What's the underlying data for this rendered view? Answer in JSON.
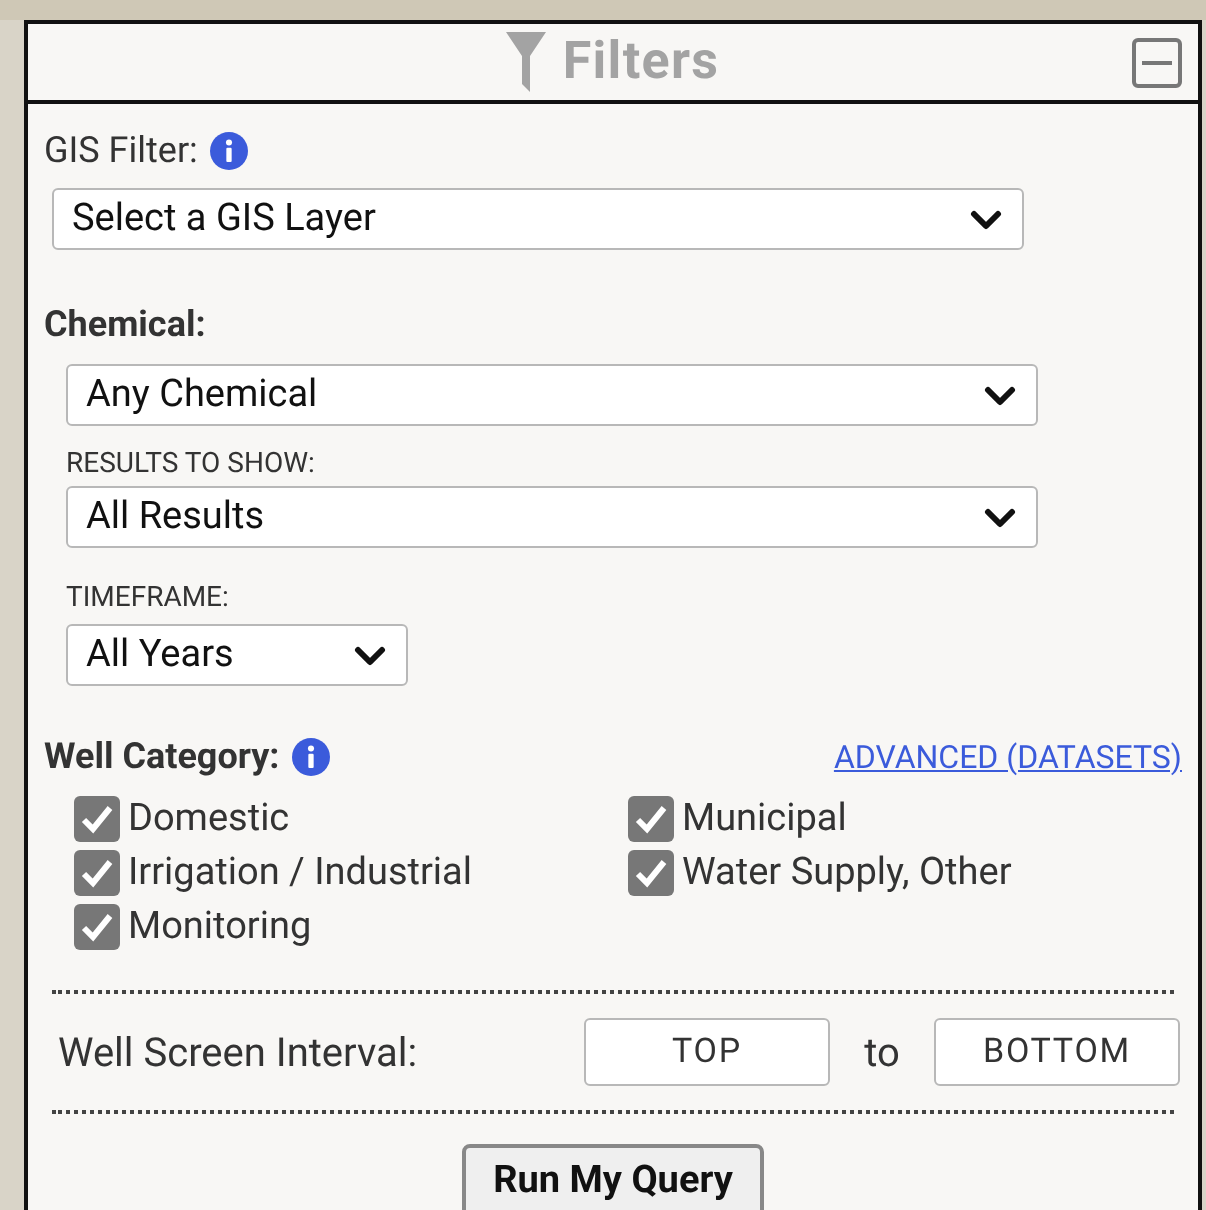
{
  "panel": {
    "title": "Filters",
    "collapsed": false
  },
  "gis_filter": {
    "label": "GIS Filter:",
    "select": "Select a GIS Layer"
  },
  "chemical": {
    "label": "Chemical:",
    "select": "Any Chemical"
  },
  "results_to_show": {
    "label": "RESULTS TO SHOW:",
    "select": "All Results"
  },
  "timeframe": {
    "label": "TIMEFRAME:",
    "select": "All Years"
  },
  "well_category": {
    "label": "Well Category:",
    "link": "ADVANCED (DATASETS)",
    "options": [
      {
        "label": "Domestic",
        "checked": true
      },
      {
        "label": "Municipal",
        "checked": true
      },
      {
        "label": "Irrigation / Industrial",
        "checked": true
      },
      {
        "label": "Water Supply, Other",
        "checked": true
      },
      {
        "label": "Monitoring",
        "checked": true
      }
    ]
  },
  "well_screen_interval": {
    "label": "Well Screen Interval:",
    "top_placeholder": "TOP",
    "separator": "to",
    "bottom_placeholder": "BOTTOM"
  },
  "run_button": "Run My Query"
}
